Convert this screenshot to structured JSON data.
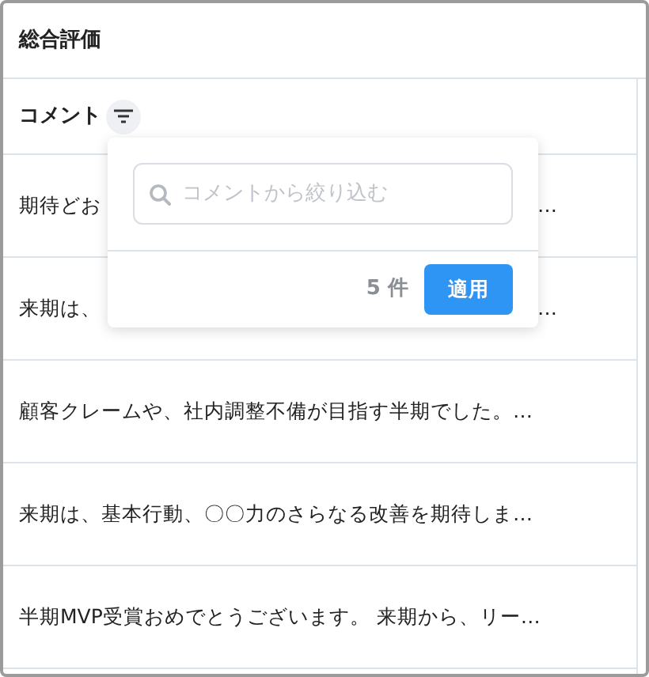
{
  "table": {
    "title": "総合評価",
    "column": {
      "label": "コメント",
      "filter_active": true
    },
    "rows": [
      {
        "fragments": [
          "期待どお",
          "…"
        ]
      },
      {
        "fragments": [
          "来期は、",
          "…"
        ]
      },
      {
        "fragments": [
          "顧客クレームや、社内調整不備が目指す半期でした。…"
        ]
      },
      {
        "fragments": [
          "来期は、基本行動、〇〇力のさらなる改善を期待しま…"
        ]
      },
      {
        "fragments": [
          "半期MVP受賞おめでとうございます。 来期から、リー…"
        ]
      }
    ]
  },
  "filter_popup": {
    "search": {
      "placeholder": "コメントから絞り込む"
    },
    "count": "5 件",
    "apply_button": "適用"
  }
}
